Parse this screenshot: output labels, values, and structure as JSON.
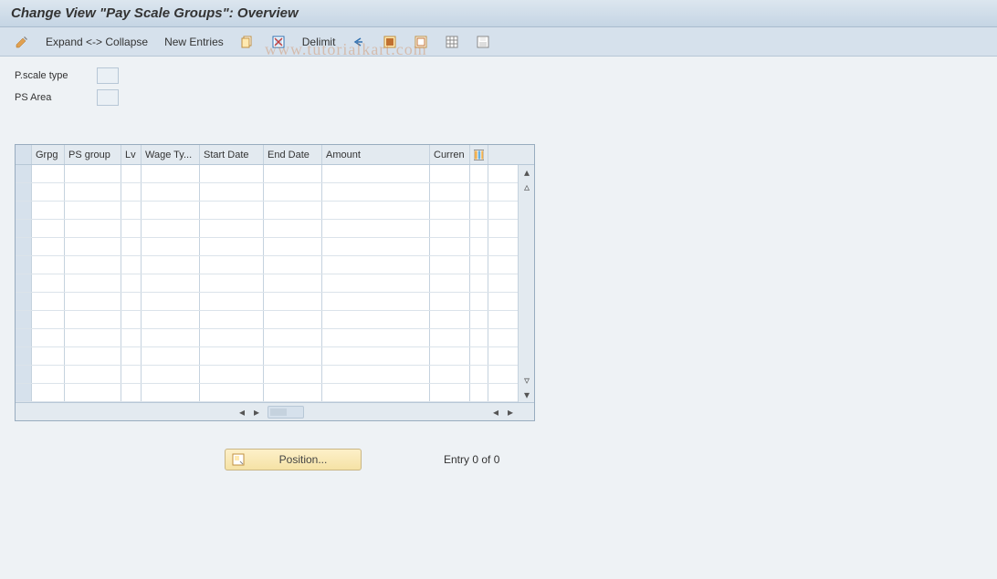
{
  "title": "Change View \"Pay Scale Groups\": Overview",
  "watermark": "www.tutorialkart.com",
  "toolbar": {
    "expand_collapse": "Expand <-> Collapse",
    "new_entries": "New Entries",
    "delimit": "Delimit"
  },
  "form": {
    "pscale_type_label": "P.scale type",
    "pscale_type_value": "",
    "ps_area_label": "PS Area",
    "ps_area_value": ""
  },
  "table": {
    "columns": [
      "Grpg",
      "PS group",
      "Lv",
      "Wage Ty...",
      "Start Date",
      "End Date",
      "Amount",
      "Curren"
    ],
    "row_count": 13
  },
  "footer": {
    "position_label": "Position...",
    "entry_text": "Entry 0 of 0"
  }
}
